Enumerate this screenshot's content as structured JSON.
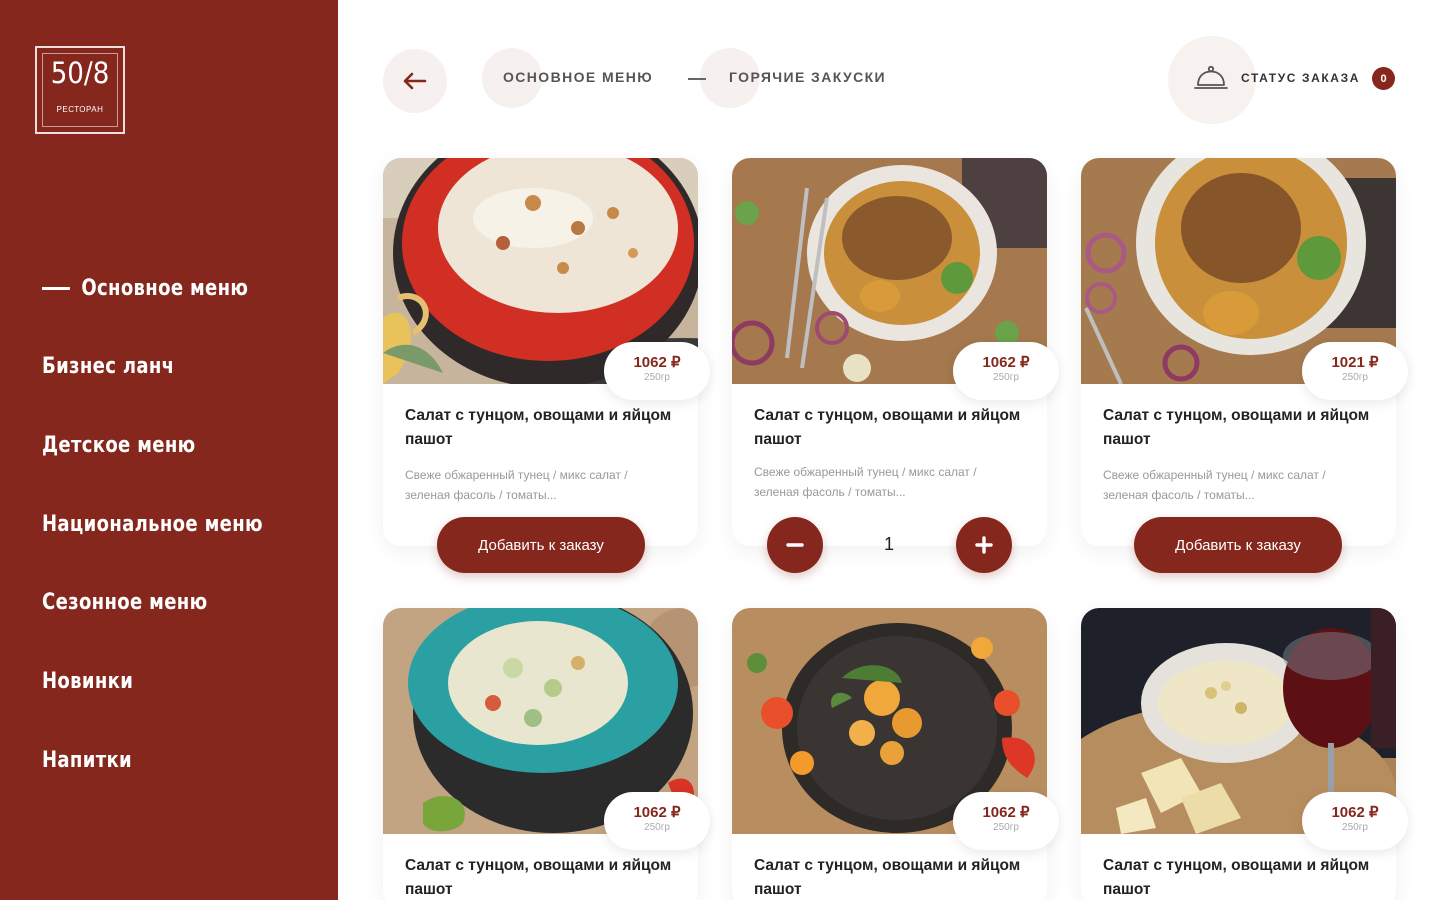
{
  "logo": {
    "number": "50/8",
    "subtitle": "РЕСТОРАН"
  },
  "sidebar": {
    "items": [
      {
        "label": "Основное меню",
        "active": true
      },
      {
        "label": "Бизнес ланч",
        "active": false
      },
      {
        "label": "Детское меню",
        "active": false
      },
      {
        "label": "Национальное меню",
        "active": false
      },
      {
        "label": "Сезонное меню",
        "active": false
      },
      {
        "label": "Новинки",
        "active": false
      },
      {
        "label": "Напитки",
        "active": false
      }
    ]
  },
  "header": {
    "back_icon": "arrow-left-icon",
    "breadcrumb": [
      "ОСНОВНОЕ МЕНЮ",
      "ГОРЯЧИЕ ЗАКУСКИ"
    ],
    "order_status": {
      "icon": "cloche-icon",
      "label": "СТАТУС ЗАКАЗА",
      "count": "0"
    }
  },
  "colors": {
    "brand": "#85271d",
    "soft": "#f6f1ef"
  },
  "cards": [
    {
      "price": "1062 ₽",
      "weight": "250гр",
      "title": "Салат с тунцом, овощами и яйцом пашот",
      "desc": "Свеже обжаренный тунец / микс салат / зеленая фасоль / томаты...",
      "button": "Добавить к заказу"
    },
    {
      "price": "1062 ₽",
      "weight": "250гр",
      "title": "Салат с тунцом, овощами и яйцом пашот",
      "desc": "Свеже обжаренный тунец / микс салат / зеленая фасоль / томаты...",
      "quantity": "1"
    },
    {
      "price": "1021 ₽",
      "weight": "250гр",
      "title": "Салат с тунцом, овощами и яйцом пашот",
      "desc": "Свеже обжаренный тунец / микс салат / зеленая фасоль / томаты...",
      "button": "Добавить к заказу"
    },
    {
      "price": "1062 ₽",
      "weight": "250гр",
      "title": "Салат с тунцом, овощами и яйцом пашот"
    },
    {
      "price": "1062 ₽",
      "weight": "250гр",
      "title": "Салат с тунцом, овощами и яйцом пашот"
    },
    {
      "price": "1062 ₽",
      "weight": "250гр",
      "title": "Салат с тунцом, овощами и яйцом пашот"
    }
  ]
}
